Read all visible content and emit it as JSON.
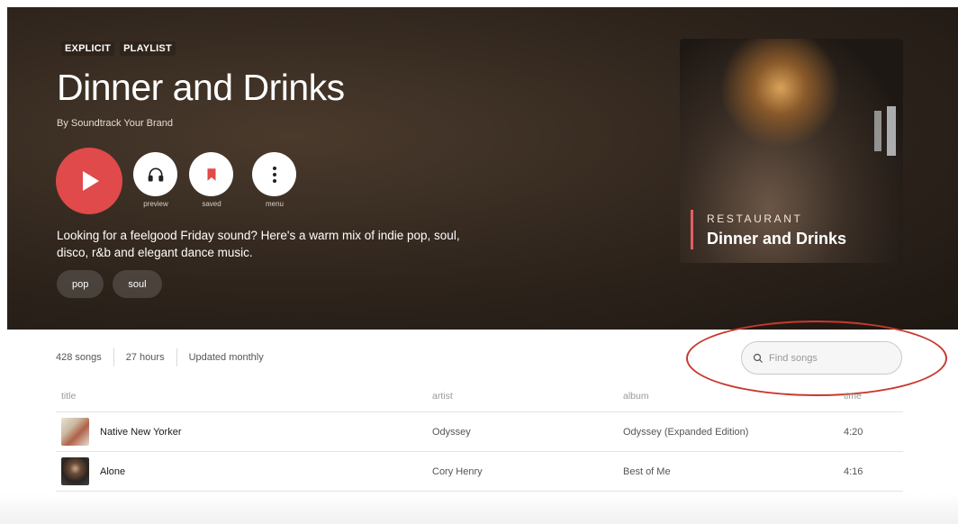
{
  "hero": {
    "tags": [
      "EXPLICIT",
      "PLAYLIST"
    ],
    "title": "Dinner and Drinks",
    "byline": "By Soundtrack Your Brand",
    "description": "Looking for a feelgood Friday sound? Here's a warm mix of indie pop, soul, disco, r&b and elegant dance music.",
    "genres": [
      "pop",
      "soul"
    ],
    "controls": {
      "preview_label": "preview",
      "saved_label": "saved",
      "menu_label": "menu"
    },
    "cover": {
      "kicker": "RESTAURANT",
      "title": "Dinner and Drinks"
    },
    "colors": {
      "play": "#e04a4a",
      "accent": "#e04a4a"
    }
  },
  "stats": {
    "songs": "428 songs",
    "duration": "27 hours",
    "update": "Updated monthly"
  },
  "search": {
    "placeholder": "Find songs"
  },
  "table": {
    "headers": {
      "title": "title",
      "artist": "artist",
      "album": "album",
      "time": "time"
    },
    "rows": [
      {
        "title": "Native New Yorker",
        "artist": "Odyssey",
        "album": "Odyssey (Expanded Edition)",
        "time": "4:20"
      },
      {
        "title": "Alone",
        "artist": "Cory Henry",
        "album": "Best of Me",
        "time": "4:16"
      }
    ]
  }
}
